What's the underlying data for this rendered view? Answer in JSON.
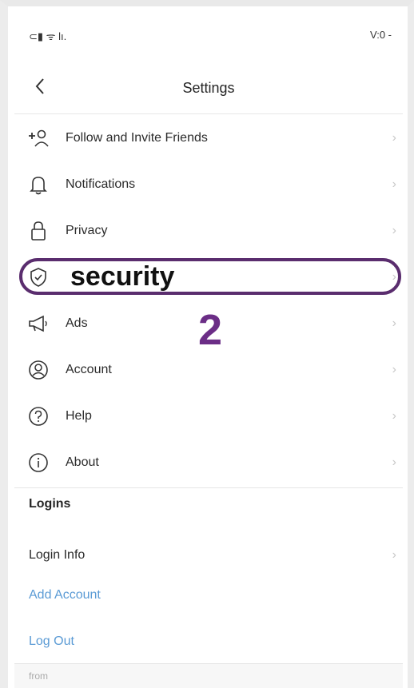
{
  "status": {
    "left": "⊂▮ ᯤ lı.",
    "right": "V:0 -"
  },
  "nav": {
    "title": "Settings",
    "back_icon": "chevron-left-icon"
  },
  "menu": [
    {
      "label": "Follow and Invite Friends",
      "icon": "add-person-icon"
    },
    {
      "label": "Notifications",
      "icon": "bell-icon"
    },
    {
      "label": "Privacy",
      "icon": "lock-icon"
    },
    {
      "label": "security",
      "icon": "shield-icon"
    },
    {
      "label": "Ads",
      "icon": "megaphone-icon"
    },
    {
      "label": "Account",
      "icon": "account-icon"
    },
    {
      "label": "Help",
      "icon": "help-icon"
    },
    {
      "label": "About",
      "icon": "info-icon"
    }
  ],
  "logins": {
    "header": "Logins",
    "login_info": "Login Info",
    "add_account": "Add Account",
    "log_out": "Log Out"
  },
  "annotation": {
    "step": "2",
    "color": "#6b2d86"
  },
  "footer": {
    "from": "from"
  },
  "chevron": "›"
}
